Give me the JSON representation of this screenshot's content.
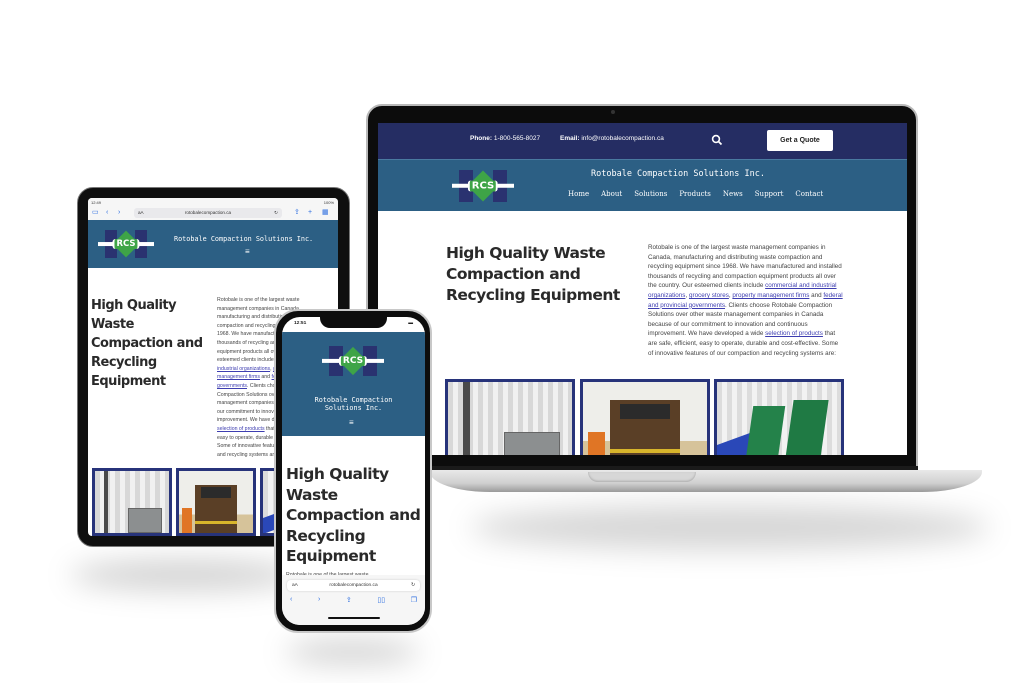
{
  "site": {
    "brand": "Rotobale Compaction Solutions Inc.",
    "brand_mobile_line1": "Rotobale Compaction",
    "brand_mobile_line2": "Solutions Inc.",
    "logo_text": "RCS",
    "domain": "rotobalecompaction.ca",
    "heading": "High Quality Waste Compaction and Recycling Equipment",
    "colors": {
      "navy": "#252d63",
      "blue": "#2c5f84",
      "green": "#3ea447",
      "link": "#3d3db0"
    }
  },
  "topbar": {
    "phone_label": "Phone:",
    "phone_value": "1-800-565-8027",
    "email_label": "Email:",
    "email_value": "info@rotobalecompaction.ca",
    "search_icon": "search-icon",
    "quote_button": "Get a Quote"
  },
  "nav": {
    "items": [
      {
        "label": "Home"
      },
      {
        "label": "About"
      },
      {
        "label": "Solutions"
      },
      {
        "label": "Products"
      },
      {
        "label": "News"
      },
      {
        "label": "Support"
      },
      {
        "label": "Contact"
      }
    ],
    "menu_icon": "≡"
  },
  "intro": {
    "p1": "Rotobale is one of the largest waste management companies in Canada, manufacturing and distributing waste compaction and recycling equipment since 1968. We have manufactured and installed thousands of recycling and compaction equipment products all over the country. Our esteemed clients include ",
    "link1": "commercial and industrial organizations",
    "sep1": ", ",
    "link2": "grocery stores",
    "sep2": ", ",
    "link3": "property management firms",
    "sep3": " and ",
    "link4": "federal and provincial governments",
    "p2": ". Clients choose Rotobale Compaction Solutions over other waste management companies in Canada because of our commitment to innovation and continuous improvement. We have developed a wide ",
    "link5": "selection of products",
    "p3": " that are safe, efficient, easy to operate, durable and cost-effective. Some of innovative features of our compaction and recycling systems are:",
    "mobile_preview": "Rotobale is one of the largest waste"
  },
  "tablet": {
    "time": "12:49",
    "battery": "100%",
    "aa": "aA",
    "dots": "•••"
  },
  "phone": {
    "time": "12:51",
    "aa": "aA"
  }
}
